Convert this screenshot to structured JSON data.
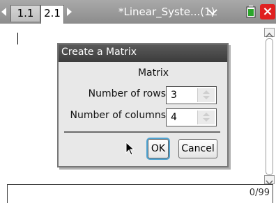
{
  "tabs": [
    {
      "label": "1.1",
      "active": false
    },
    {
      "label": "2.1",
      "active": true
    }
  ],
  "document_title": "*Linear_Syste...(1)",
  "icons": {
    "nav_left": "triangle-left-icon",
    "nav_right": "triangle-right-icon",
    "title_menu": "chevron-down-icon",
    "battery": "battery-icon",
    "close": "close-icon",
    "pointer": "mouse-pointer-icon"
  },
  "colors": {
    "close_button": "#e02020",
    "focus_ring": "#4fa3d1",
    "dialog_titlebar": "#4a4a4a"
  },
  "status": {
    "entry_count": "0/99"
  },
  "dialog": {
    "title": "Create a Matrix",
    "heading": "Matrix",
    "rows_label": "Number of rows",
    "rows_value": "3",
    "columns_label": "Number of columns",
    "columns_value": "4",
    "ok_label": "OK",
    "cancel_label": "Cancel"
  }
}
